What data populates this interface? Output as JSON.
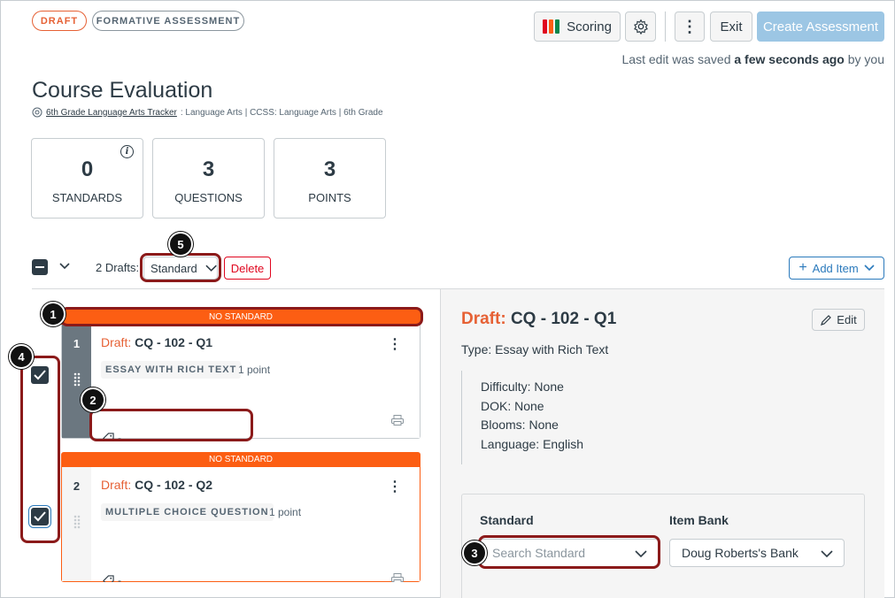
{
  "header": {
    "status_pill": "DRAFT",
    "type_pill": "FORMATIVE ASSESSMENT",
    "scoring_label": "Scoring",
    "exit_label": "Exit",
    "create_label": "Create Assessment",
    "saved_prefix": "Last edit was saved",
    "saved_time": "a few seconds ago",
    "saved_suffix": "by you"
  },
  "assessment": {
    "title": "Course Evaluation",
    "tracker_link": "6th Grade Language Arts Tracker",
    "meta": ": Language Arts | CCSS: Language Arts | 6th Grade"
  },
  "stats": [
    {
      "value": "0",
      "label": "STANDARDS"
    },
    {
      "value": "3",
      "label": "QUESTIONS"
    },
    {
      "value": "3",
      "label": "POINTS"
    }
  ],
  "toolbar": {
    "drafts_label": "2 Drafts:",
    "filter_value": "Standard",
    "delete_label": "Delete",
    "add_item_label": "Add Item"
  },
  "questions": [
    {
      "number": "1",
      "banner": "NO STANDARD",
      "draft_prefix": "Draft:",
      "title": "CQ - 102 - Q1",
      "type": "ESSAY WITH RICH TEXT",
      "points": "1 point",
      "standard": "-",
      "checked": true,
      "selected": true
    },
    {
      "number": "2",
      "banner": "NO STANDARD",
      "draft_prefix": "Draft:",
      "title": "CQ - 102 - Q2",
      "type": "MULTIPLE CHOICE QUESTION",
      "points": "1 point",
      "standard": "-",
      "checked": true,
      "selected": false
    }
  ],
  "detail": {
    "draft_prefix": "Draft:",
    "title": "CQ - 102 - Q1",
    "edit_label": "Edit",
    "type_line": "Type: Essay with Rich Text",
    "attributes": [
      "Difficulty: None",
      "DOK: None",
      "Blooms: None",
      "Language: English"
    ],
    "standard_label": "Standard",
    "standard_placeholder": "Search Standard",
    "bank_label": "Item Bank",
    "bank_value": "Doug Roberts's Bank"
  },
  "callouts": [
    "1",
    "2",
    "3",
    "4",
    "5"
  ],
  "colors": {
    "accent_orange": "#fc5e13",
    "draft_orange": "#e66135",
    "primary_disabled": "#9cc6e4",
    "link_blue": "#2b7abc",
    "danger_red": "#e0061f",
    "callout_red": "#8b1a1a",
    "text_dark": "#2d3b45"
  }
}
